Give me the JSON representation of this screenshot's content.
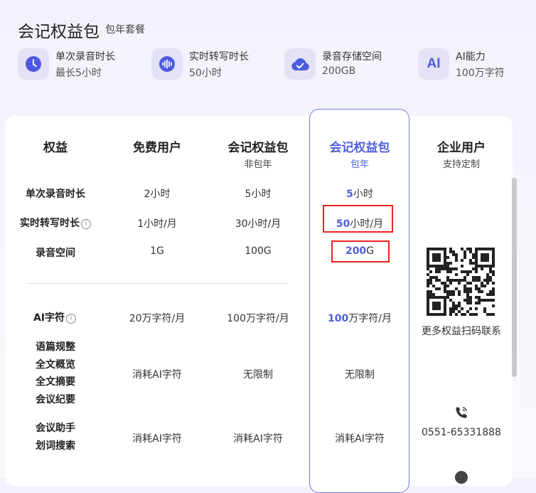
{
  "header": {
    "title": "会记权益包",
    "subtitle": "包年套餐"
  },
  "features": [
    {
      "icon": "clock-icon",
      "line1": "单次录音时长",
      "line2": "最长5小时"
    },
    {
      "icon": "audio-wave-icon",
      "line1": "实时转写时长",
      "line2": "50小时"
    },
    {
      "icon": "cloud-check-icon",
      "line1": "录音存储空间",
      "line2": "200GB"
    },
    {
      "icon": "ai-icon",
      "line1": "AI能力",
      "line2": "100万字符",
      "icon_text": "AI"
    }
  ],
  "columns": [
    {
      "title": "权益",
      "sub": ""
    },
    {
      "title": "免费用户",
      "sub": ""
    },
    {
      "title": "会记权益包",
      "sub": "非包年"
    },
    {
      "title": "会记权益包",
      "sub": "包年"
    },
    {
      "title": "企业用户",
      "sub": "支持定制"
    }
  ],
  "rows": {
    "duration": {
      "label": "单次录音时长",
      "free": "2小时",
      "nonyear": "5小时",
      "year_num": "5",
      "year_unit": "小时"
    },
    "transcribe": {
      "label": "实时转写时长",
      "info": "i",
      "free": "1小时/月",
      "nonyear": "30小时/月",
      "year_num": "50",
      "year_unit": "小时/月"
    },
    "storage": {
      "label": "录音空间",
      "free": "1G",
      "nonyear": "100G",
      "year_num": "200",
      "year_unit": "G"
    },
    "ai": {
      "label": "AI字符",
      "info": "i",
      "free": "20万字符/月",
      "nonyear": "100万字符/月",
      "year_num": "100",
      "year_unit": "万字符/月"
    },
    "features_a": {
      "labels": [
        "语篇规整",
        "全文概览",
        "全文摘要",
        "会议纪要"
      ],
      "free": "消耗AI字符",
      "nonyear": "无限制",
      "year": "无限制"
    },
    "features_b": {
      "labels": [
        "会议助手",
        "划词搜索"
      ],
      "free": "消耗AI字符",
      "nonyear": "消耗AI字符",
      "year": "消耗AI字符"
    }
  },
  "enterprise": {
    "qr_caption": "更多权益扫码联系",
    "phone": "0551-65331888"
  },
  "colors": {
    "accent": "#4f5fe0",
    "highlight_border": "#e22222"
  }
}
